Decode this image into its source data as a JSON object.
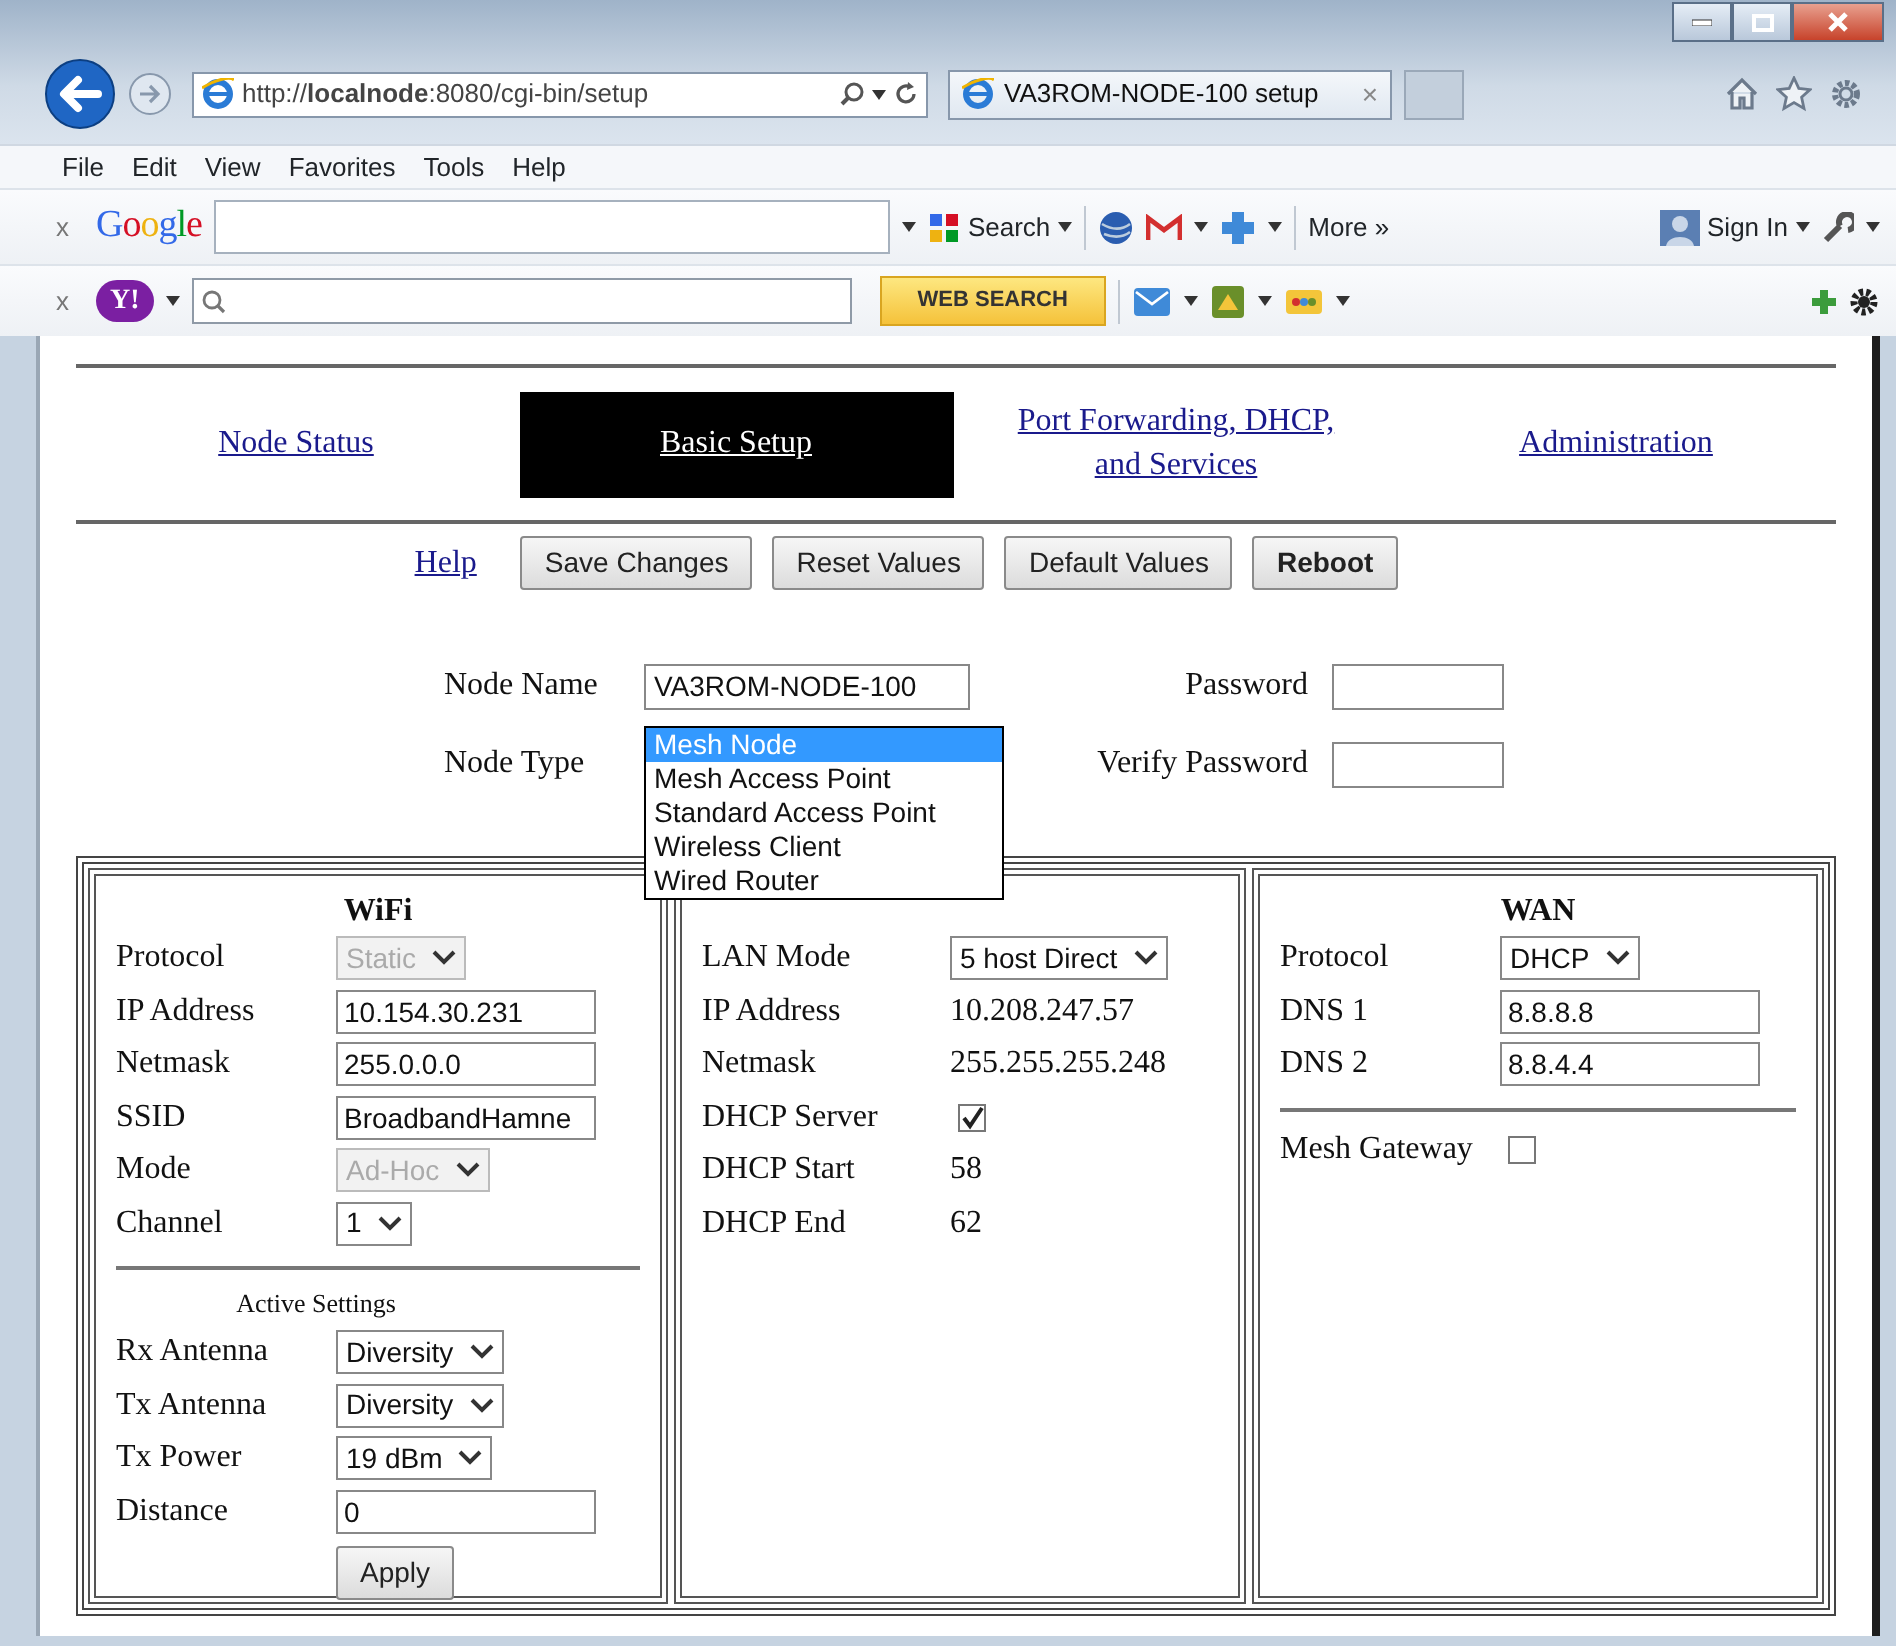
{
  "browser": {
    "address": "http://**localnode**:8080/cgi-bin/setup",
    "tab": {
      "title": "VA3ROM-NODE-100 setup",
      "close": "×"
    },
    "menu": [
      "File",
      "Edit",
      "View",
      "Favorites",
      "Tools",
      "Help"
    ],
    "google_toolbar": {
      "close": "x",
      "logo": "Google",
      "search_button": "Search",
      "more": "More »",
      "sign_in": "Sign In"
    },
    "yahoo_toolbar": {
      "close": "x",
      "logo": "Y!",
      "search_button": "WEB SEARCH"
    }
  },
  "page": {
    "nav": [
      {
        "label": "Node Status",
        "selected": false
      },
      {
        "label": "Basic Setup",
        "selected": true
      },
      {
        "label": "Port Forwarding, DHCP, and Services",
        "selected": false
      },
      {
        "label": "Administration",
        "selected": false
      }
    ],
    "help_link": "Help",
    "buttons": [
      {
        "label": "Save Changes",
        "kind": "normal"
      },
      {
        "label": "Reset Values",
        "kind": "normal"
      },
      {
        "label": "Default Values",
        "kind": "normal"
      },
      {
        "label": "Reboot",
        "kind": "strong"
      }
    ],
    "node_name": {
      "label": "Node Name",
      "value": "VA3ROM-NODE-100"
    },
    "password": {
      "label": "Password"
    },
    "node_type": {
      "label": "Node Type",
      "expanded": true,
      "options": [
        {
          "label": "Mesh Node",
          "selected": true
        },
        {
          "label": "Mesh Access Point",
          "selected": false
        },
        {
          "label": "Standard Access Point",
          "selected": false
        },
        {
          "label": "Wireless Client",
          "selected": false
        },
        {
          "label": "Wired Router",
          "selected": false
        }
      ]
    },
    "verify_password": {
      "label": "Verify Password"
    },
    "panels": [
      {
        "title": "WiFi",
        "rows": [
          {
            "kind": "select",
            "label": "Protocol",
            "value": "Static",
            "disabled": true
          },
          {
            "kind": "input",
            "label": "IP Address",
            "value": "10.154.30.231"
          },
          {
            "kind": "input",
            "label": "Netmask",
            "value": "255.0.0.0"
          },
          {
            "kind": "input",
            "label": "SSID",
            "value": "BroadbandHamne"
          },
          {
            "kind": "select",
            "label": "Mode",
            "value": "Ad-Hoc",
            "disabled": true
          },
          {
            "kind": "select",
            "label": "Channel",
            "value": "1",
            "disabled": false
          },
          {
            "kind": "divider"
          },
          {
            "kind": "heading",
            "label": "Active Settings"
          },
          {
            "kind": "select",
            "label": "Rx Antenna",
            "value": "Diversity",
            "disabled": false
          },
          {
            "kind": "select",
            "label": "Tx Antenna",
            "value": "Diversity",
            "disabled": false
          },
          {
            "kind": "select",
            "label": "Tx Power",
            "value": "19 dBm",
            "disabled": false
          },
          {
            "kind": "input",
            "label": "Distance",
            "value": "0"
          },
          {
            "kind": "button",
            "label": "Apply"
          }
        ]
      },
      {
        "rows": [
          {
            "kind": "select",
            "label": "LAN Mode",
            "value": "5 host Direct",
            "disabled": false
          },
          {
            "kind": "text",
            "label": "IP Address",
            "value": "10.208.247.57"
          },
          {
            "kind": "text",
            "label": "Netmask",
            "value": "255.255.255.248"
          },
          {
            "kind": "checkbox",
            "label": "DHCP Server",
            "checked": true
          },
          {
            "kind": "text",
            "label": "DHCP Start",
            "value": "58"
          },
          {
            "kind": "text",
            "label": "DHCP End",
            "value": "62"
          }
        ]
      },
      {
        "title": "WAN",
        "rows": [
          {
            "kind": "select",
            "label": "Protocol",
            "value": "DHCP",
            "disabled": false
          },
          {
            "kind": "input",
            "label": "DNS 1",
            "value": "8.8.8.8"
          },
          {
            "kind": "input",
            "label": "DNS 2",
            "value": "8.8.4.4"
          },
          {
            "kind": "divider"
          },
          {
            "kind": "checkbox",
            "label": "Mesh Gateway",
            "checked": false
          }
        ]
      }
    ]
  }
}
